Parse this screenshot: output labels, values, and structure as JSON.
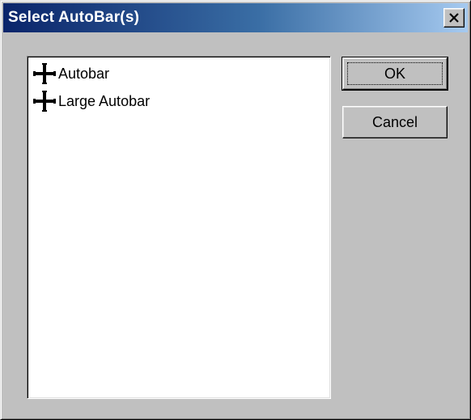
{
  "window": {
    "title": "Select AutoBar(s)",
    "close_symbol": "✕"
  },
  "list": {
    "items": [
      {
        "label": "Autobar",
        "icon": "move-cross-icon"
      },
      {
        "label": "Large Autobar",
        "icon": "move-cross-icon"
      }
    ]
  },
  "buttons": {
    "ok_label": "OK",
    "cancel_label": "Cancel"
  }
}
